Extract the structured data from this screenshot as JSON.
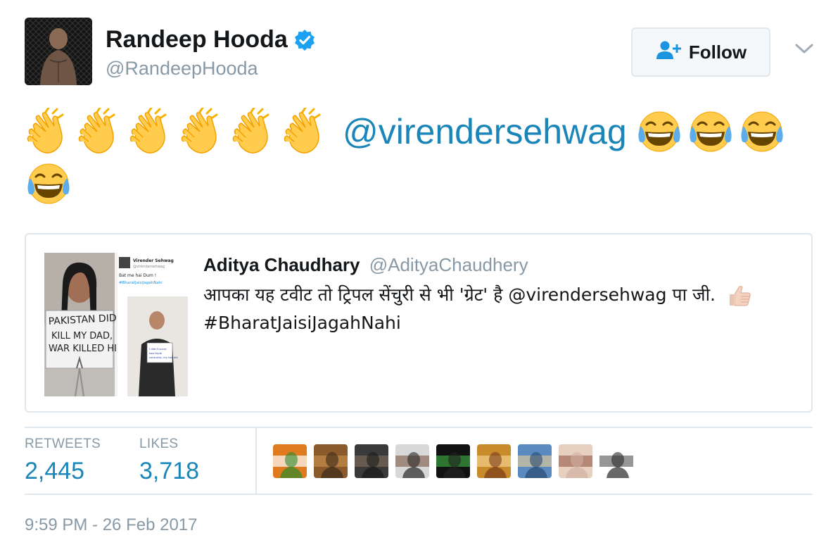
{
  "header": {
    "display_name": "Randeep Hooda",
    "handle": "@RandeepHooda",
    "follow_label": "Follow"
  },
  "tweet": {
    "clap_emoji_count": 6,
    "mention": "@virendersehwag",
    "laugh_emoji_count": 4
  },
  "quote": {
    "author_name": "Aditya Chaudhary",
    "author_handle": "@AdityaChaudhery",
    "text_line1": "आपका यह टवीट तो ट्रिपल सेंचुरी से भी 'ग्रेट' है @virendersehwag पा जी.",
    "hashtag": "#BharatJaisiJagahNahi",
    "media": {
      "poster_text": "PAKISTAN DID KILL MY DAD, WAR KILLED HI",
      "inner_tweet_name": "Virender Sehwag",
      "inner_tweet_handle": "@virendersehwag",
      "inner_tweet_text": "Bat me hai Dum !",
      "inner_tweet_tag": "#BharatJaisiJagahNahi",
      "inner_sign_text": "I didn't score two triple centuries, my bat did"
    }
  },
  "stats": {
    "retweets_label": "RETWEETS",
    "retweets_value": "2,445",
    "likes_label": "LIKES",
    "likes_value": "3,718",
    "liker_count": 9
  },
  "timestamp": "9:59 PM - 26 Feb 2017",
  "colors": {
    "link": "#1b95e0",
    "muted": "#8899a6",
    "border": "#e1e8ed",
    "verified": "#1da1f2"
  },
  "icons": {
    "verified": "verified-badge-icon",
    "follow": "add-person-icon",
    "more": "chevron-down-icon",
    "clap": "clapping-hands-emoji",
    "laugh": "tears-of-joy-emoji",
    "thumb": "thumbs-up-emoji"
  }
}
